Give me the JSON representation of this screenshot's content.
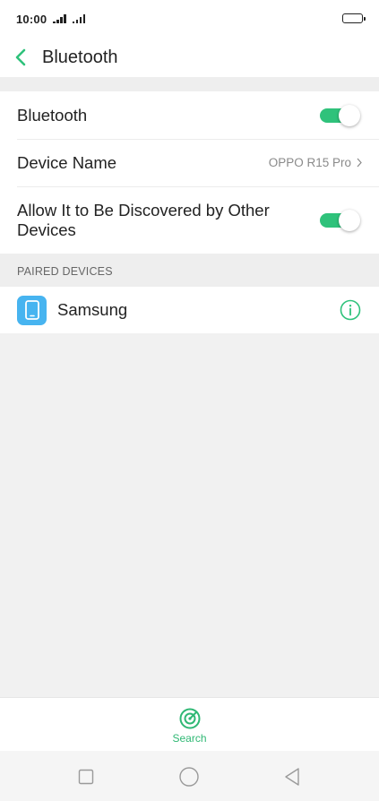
{
  "status_bar": {
    "time": "10:00"
  },
  "header": {
    "title": "Bluetooth",
    "back_icon": "chevron-left-icon"
  },
  "settings": {
    "bluetooth": {
      "label": "Bluetooth",
      "enabled": true
    },
    "device_name": {
      "label": "Device Name",
      "value": "OPPO R15 Pro"
    },
    "discoverable": {
      "label": "Allow It to Be Discovered by Other Devices",
      "enabled": true
    }
  },
  "paired": {
    "section_title": "PAIRED DEVICES",
    "devices": [
      {
        "name": "Samsung",
        "icon": "phone-icon"
      }
    ]
  },
  "bottom_bar": {
    "search_label": "Search",
    "search_icon": "radar-search-icon"
  },
  "nav_bar": {
    "icons": [
      "square-icon",
      "circle-icon",
      "triangle-back-icon"
    ]
  },
  "colors": {
    "accent": "#2fc27b",
    "device_icon_bg": "#47b4f0",
    "background": "#f1f1f1",
    "card": "#ffffff"
  }
}
